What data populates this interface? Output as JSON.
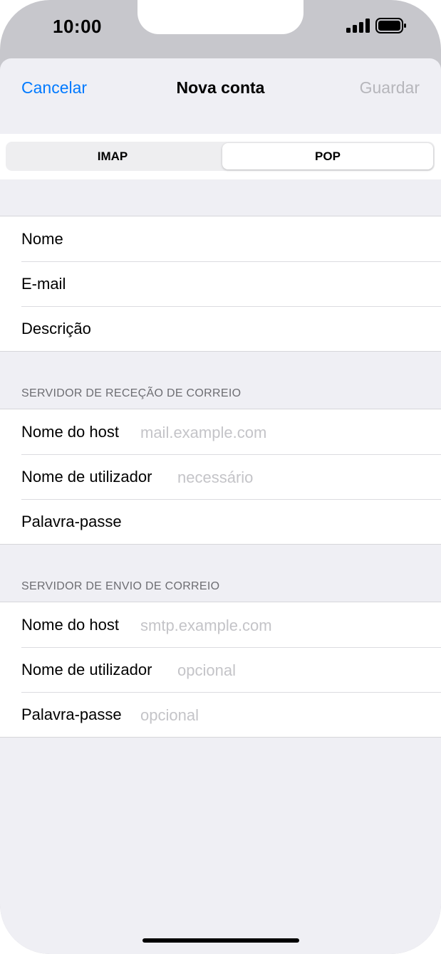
{
  "status_bar": {
    "time": "10:00",
    "icons": [
      "signal-icon",
      "battery-icon"
    ]
  },
  "nav": {
    "cancel": "Cancelar",
    "title": "Nova conta",
    "save": "Guardar"
  },
  "segments": {
    "left": "IMAP",
    "right": "POP",
    "selected": "POP"
  },
  "account": {
    "rows": [
      {
        "label": "Nome"
      },
      {
        "label": "E-mail"
      },
      {
        "label": "Descrição"
      }
    ]
  },
  "incoming": {
    "header": "SERVIDOR DE RECEÇÃO DE CORREIO",
    "rows": [
      {
        "label": "Nome do host",
        "placeholder": "mail.example.com"
      },
      {
        "label": "Nome de utilizador",
        "placeholder": "necessário"
      },
      {
        "label": "Palavra-passe"
      }
    ]
  },
  "outgoing": {
    "header": "SERVIDOR DE ENVIO DE CORREIO",
    "rows": [
      {
        "label": "Nome do host",
        "placeholder": "smtp.example.com"
      },
      {
        "label": "Nome de utilizador",
        "placeholder": "opcional"
      },
      {
        "label": "Palavra-passe",
        "placeholder": "opcional"
      }
    ]
  },
  "colors": {
    "accent": "#007aff",
    "disabled": "#b6b6bb",
    "background": "#efeff4",
    "placeholder": "#c4c4c8"
  }
}
